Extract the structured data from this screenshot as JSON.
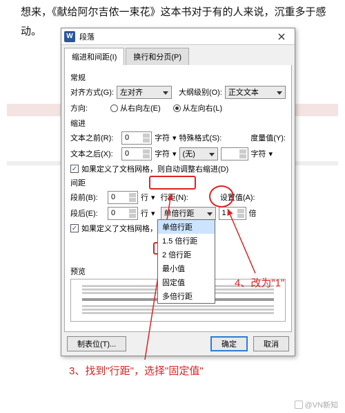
{
  "bg_text": "想来，《献给阿尔吉侬一束花》这本书对于有的人来说，沉重多于感动。",
  "dialog": {
    "title": "段落",
    "tabs": {
      "indent": "缩进和间距(I)",
      "page": "换行和分页(P)"
    },
    "s_general": "常规",
    "align_label": "对齐方式(G):",
    "align_value": "左对齐",
    "outline_label": "大纲级别(O):",
    "outline_value": "正文文本",
    "dir_label": "方向:",
    "dir_rtl": "从右向左(E)",
    "dir_ltr": "从左向右(L)",
    "s_indent": "缩进",
    "before_label": "文本之前(R):",
    "before_val": "0",
    "char_unit": "字符",
    "special_label": "特殊格式(S):",
    "metric_label": "度量值(Y):",
    "after_label": "文本之后(X):",
    "after_val": "0",
    "special_value": "(无)",
    "chk_grid_indent": "如果定义了文档网格，则自动调整右缩进(D)",
    "s_spacing": "间距",
    "sp_before_label": "段前(B):",
    "sp_before_val": "0",
    "line_unit": "行",
    "line_sp_label": "行距(N):",
    "set_val_label": "设置值(A):",
    "sp_after_label": "段后(E):",
    "sp_after_val": "0",
    "line_sp_value": "单倍行距",
    "set_val": "1",
    "bei": "倍",
    "chk_grid_space": "如果定义了文档网格，则与网格",
    "s_preview": "预览",
    "btn_tabs": "制表位(T)...",
    "btn_ok": "确定",
    "btn_cancel": "取消",
    "dd": {
      "o1": "单倍行距",
      "o2": "1.5 倍行距",
      "o3": "2 倍行距",
      "o4": "最小值",
      "o5": "固定值",
      "o6": "多倍行距"
    }
  },
  "annot3": "3、找到\"行距\"，选择\"固定值\"",
  "annot4": "4、改为\"1\"",
  "watermark": "@VN新知"
}
